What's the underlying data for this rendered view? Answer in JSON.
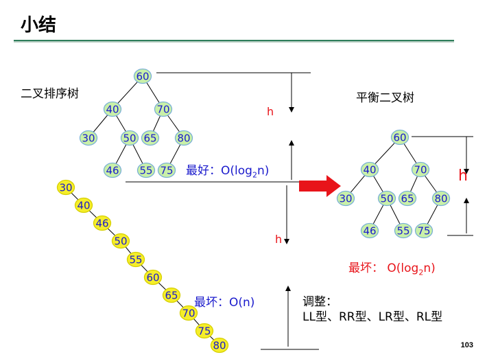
{
  "slide": {
    "title": "小结",
    "page_number": "103"
  },
  "bst": {
    "label": "二叉排序树",
    "nodes": [
      "60",
      "40",
      "70",
      "30",
      "50",
      "65",
      "80",
      "46",
      "55",
      "75"
    ]
  },
  "avl": {
    "label": "平衡二叉树",
    "nodes": [
      "60",
      "40",
      "70",
      "30",
      "50",
      "65",
      "80",
      "46",
      "55",
      "75"
    ]
  },
  "degenerate": {
    "nodes": [
      "30",
      "40",
      "46",
      "50",
      "55",
      "60",
      "65",
      "70",
      "75",
      "80"
    ]
  },
  "annotations": {
    "best_prefix": "最好：O(log",
    "best_sub": "2",
    "best_suffix": "n)",
    "worst_linear": "最坏：O(n)",
    "worst_avl_prefix": "最坏：  O(log",
    "worst_avl_sub": "2",
    "worst_avl_suffix": "n)",
    "h_left_top": "h",
    "h_left_bottom": "h",
    "h_right": "h",
    "adjust_title": "调整：",
    "adjust_types": "LL型、RR型、LR型、RL型"
  },
  "colors": {
    "node_fill_green": "#c9f0a8",
    "node_stroke_green": "#7ab0d6",
    "node_fill_yellow": "#f5ee2a",
    "node_text": "#1a1acc",
    "accent_red": "#e8141a",
    "text_blue": "#1a1acc",
    "rule_green": "#2e7d5b"
  }
}
